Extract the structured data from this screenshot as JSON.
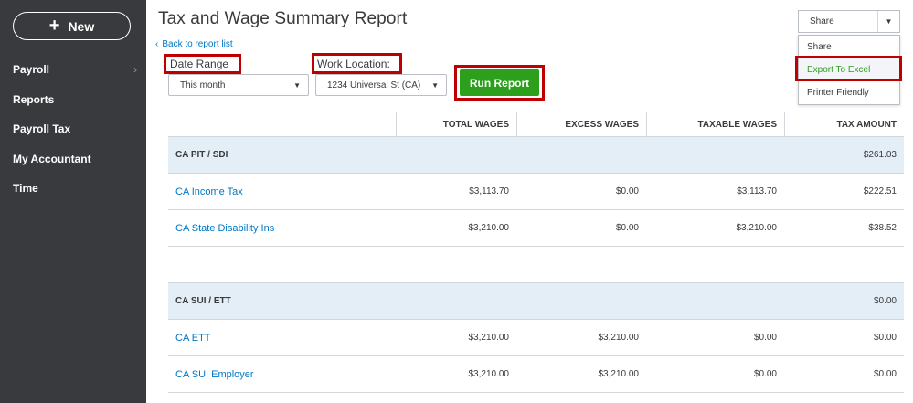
{
  "sidebar": {
    "new_label": "New",
    "items": [
      {
        "label": "Payroll",
        "has_arrow": true
      },
      {
        "label": "Reports"
      },
      {
        "label": "Payroll Tax"
      },
      {
        "label": "My Accountant"
      },
      {
        "label": "Time"
      }
    ]
  },
  "header": {
    "title": "Tax and Wage Summary Report",
    "back_label": "Back to report list"
  },
  "filters": {
    "date_range_label": "Date Range",
    "date_range_value": "This month",
    "work_location_label": "Work Location:",
    "work_location_value": "1234 Universal St (CA)",
    "run_report_label": "Run Report"
  },
  "share": {
    "selected": "Share",
    "options": [
      "Share",
      "Export To Excel",
      "Printer Friendly"
    ]
  },
  "table": {
    "columns": [
      "TOTAL WAGES",
      "EXCESS WAGES",
      "TAXABLE WAGES",
      "TAX AMOUNT"
    ],
    "sections": [
      {
        "name": "CA PIT / SDI",
        "tax_amount": "$261.03",
        "rows": [
          {
            "name": "CA Income Tax",
            "total_wages": "$3,113.70",
            "excess_wages": "$0.00",
            "taxable_wages": "$3,113.70",
            "tax_amount": "$222.51"
          },
          {
            "name": "CA State Disability Ins",
            "total_wages": "$3,210.00",
            "excess_wages": "$0.00",
            "taxable_wages": "$3,210.00",
            "tax_amount": "$38.52"
          }
        ]
      },
      {
        "name": "CA SUI / ETT",
        "tax_amount": "$0.00",
        "rows": [
          {
            "name": "CA ETT",
            "total_wages": "$3,210.00",
            "excess_wages": "$3,210.00",
            "taxable_wages": "$0.00",
            "tax_amount": "$0.00"
          },
          {
            "name": "CA SUI Employer",
            "total_wages": "$3,210.00",
            "excess_wages": "$3,210.00",
            "taxable_wages": "$0.00",
            "tax_amount": "$0.00"
          }
        ]
      }
    ]
  },
  "colors": {
    "sidebar_bg": "#393a3d",
    "accent_green": "#2ca01c",
    "link_blue": "#0077c5",
    "section_bg": "#e4eef7",
    "highlight_red": "#c00000"
  }
}
